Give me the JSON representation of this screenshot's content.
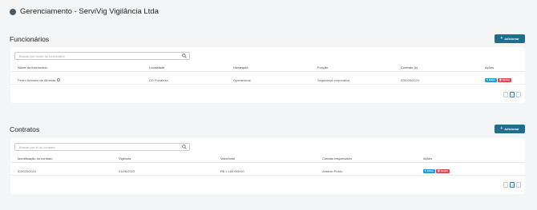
{
  "app": {
    "title": "Gerenciamento - ServiVig Vigilância Ltda"
  },
  "funcionarios": {
    "title": "Funcionários",
    "add_label": "Adicionar",
    "search_placeholder": "Buscar por nome do funcionário",
    "columns": [
      "Nome do funcionário",
      "Localidade",
      "Hierarquia",
      "Função",
      "Contrato (s)",
      "Ações"
    ],
    "rows": [
      {
        "nome": "Pedro Antunes de Almeida",
        "localidade": "CD Fortaleza",
        "hierarquia": "Operacional",
        "funcao": "Segurança corporativa",
        "contrato": "ID0025/2023"
      }
    ],
    "actions": {
      "edit": "Editar",
      "delete": "Excluir"
    },
    "pager": {
      "prev": "‹",
      "page": "1",
      "next": "›"
    }
  },
  "contratos": {
    "title": "Contratos",
    "add_label": "Adicionar",
    "search_placeholder": "Buscar por id do contrato",
    "columns": [
      "Identificação do contrato",
      "Vigência",
      "Valor total",
      "Contato responsável",
      "Ações"
    ],
    "rows": [
      {
        "id": "ID0025/2023",
        "vigencia": "21/06/2023",
        "valor": "R$ 1.180.000,00",
        "contato": "Antônio Prado"
      }
    ],
    "actions": {
      "edit": "Editar",
      "delete": "Excluir"
    },
    "pager": {
      "prev": "‹",
      "page": "1",
      "next": "›"
    }
  },
  "colors": {
    "primary": "#216d8c",
    "edit": "#1f9fd6",
    "delete": "#e1484c"
  }
}
